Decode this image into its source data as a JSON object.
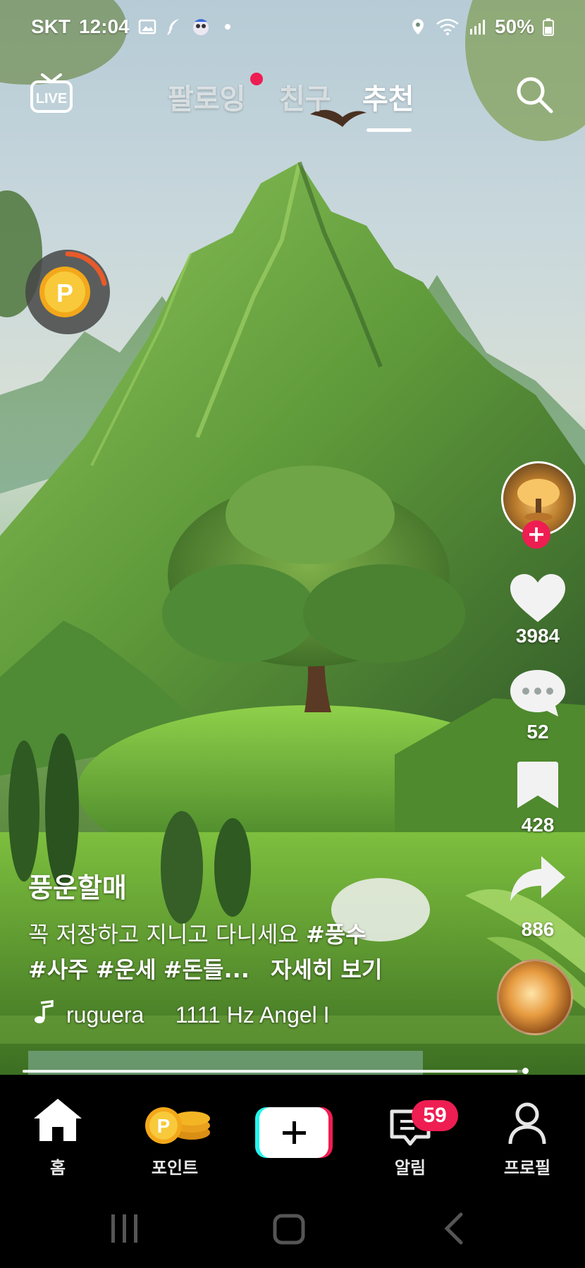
{
  "status_bar": {
    "carrier": "SKT",
    "time": "12:04",
    "battery": "50%",
    "icons": [
      "gallery-icon",
      "feather-icon",
      "app-notification-icon",
      "dot-icon",
      "location-icon",
      "wifi-icon",
      "signal-icon",
      "battery-icon"
    ]
  },
  "top_nav": {
    "live_label": "LIVE",
    "tabs": [
      {
        "label": "팔로잉",
        "active": false,
        "has_dot": true
      },
      {
        "label": "친구",
        "active": false
      },
      {
        "label": "추천",
        "active": true
      }
    ]
  },
  "video": {
    "author": "풍운할매",
    "caption_text": "꼭 저장하고 지니고 다니세요",
    "hashtags": [
      "#풍수",
      "#사주",
      "#운세",
      "#돈들..."
    ],
    "more_label": "자세히 보기",
    "music": "ruguera     1111 Hz Angel I",
    "progress": 0.98
  },
  "rail": {
    "likes": "3984",
    "comments": "52",
    "saves": "428",
    "shares": "886"
  },
  "bottom_nav": {
    "items": [
      {
        "label": "홈",
        "icon": "home-icon"
      },
      {
        "label": "포인트",
        "icon": "coins-icon"
      },
      {
        "label": "",
        "icon": "create-plus-icon"
      },
      {
        "label": "알림",
        "icon": "inbox-icon",
        "badge": "59"
      },
      {
        "label": "프로필",
        "icon": "profile-icon"
      }
    ]
  },
  "colors": {
    "accent": "#ee1d52",
    "create_cyan": "#25f4ee",
    "coin_gold": "#f6b81a",
    "background": "#000000"
  }
}
